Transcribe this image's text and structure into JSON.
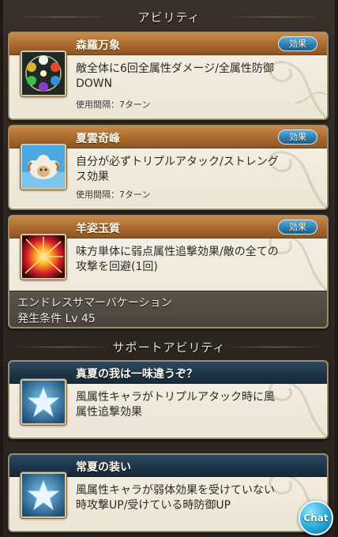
{
  "sections": {
    "abilities_title": "アビリティ",
    "support_title": "サポートアビリティ"
  },
  "abilities": [
    {
      "name": "森羅万象",
      "effect_label": "効果",
      "desc_line1": "敵全体に6回全属性ダメージ/全属性防御",
      "desc_line2": "DOWN",
      "cooldown": "使用間隔：7ターン",
      "icon": "element-orbs-icon"
    },
    {
      "name": "夏雲奇峰",
      "effect_label": "効果",
      "desc_line1": "自分が必ずトリプルアタック/ストレング",
      "desc_line2": "ス効果",
      "cooldown": "使用間隔：7ターン",
      "icon": "sheep-icon"
    },
    {
      "name": "羊姿玉質",
      "effect_label": "効果",
      "desc_line1": "味方単体に弱点属性追撃効果/敵の全ての",
      "desc_line2": "攻撃を回避(1回)",
      "unlock_name": "エンドレスサマーバケーション",
      "unlock_condition": "発生条件 Lv 45",
      "icon": "burst-icon"
    }
  ],
  "support_abilities": [
    {
      "name": "真夏の我は一味違うぞ？",
      "desc_line1": "風属性キャラがトリプルアタック時に風",
      "desc_line2": "属性追撃効果",
      "icon": "star-icon"
    },
    {
      "name": "常夏の装い",
      "desc_line1": "風属性キャラが弱体効果を受けていない",
      "desc_line2": "時攻撃UP/受けている時防御UP",
      "icon": "star-icon"
    }
  ],
  "chat": {
    "label": "Chat"
  }
}
